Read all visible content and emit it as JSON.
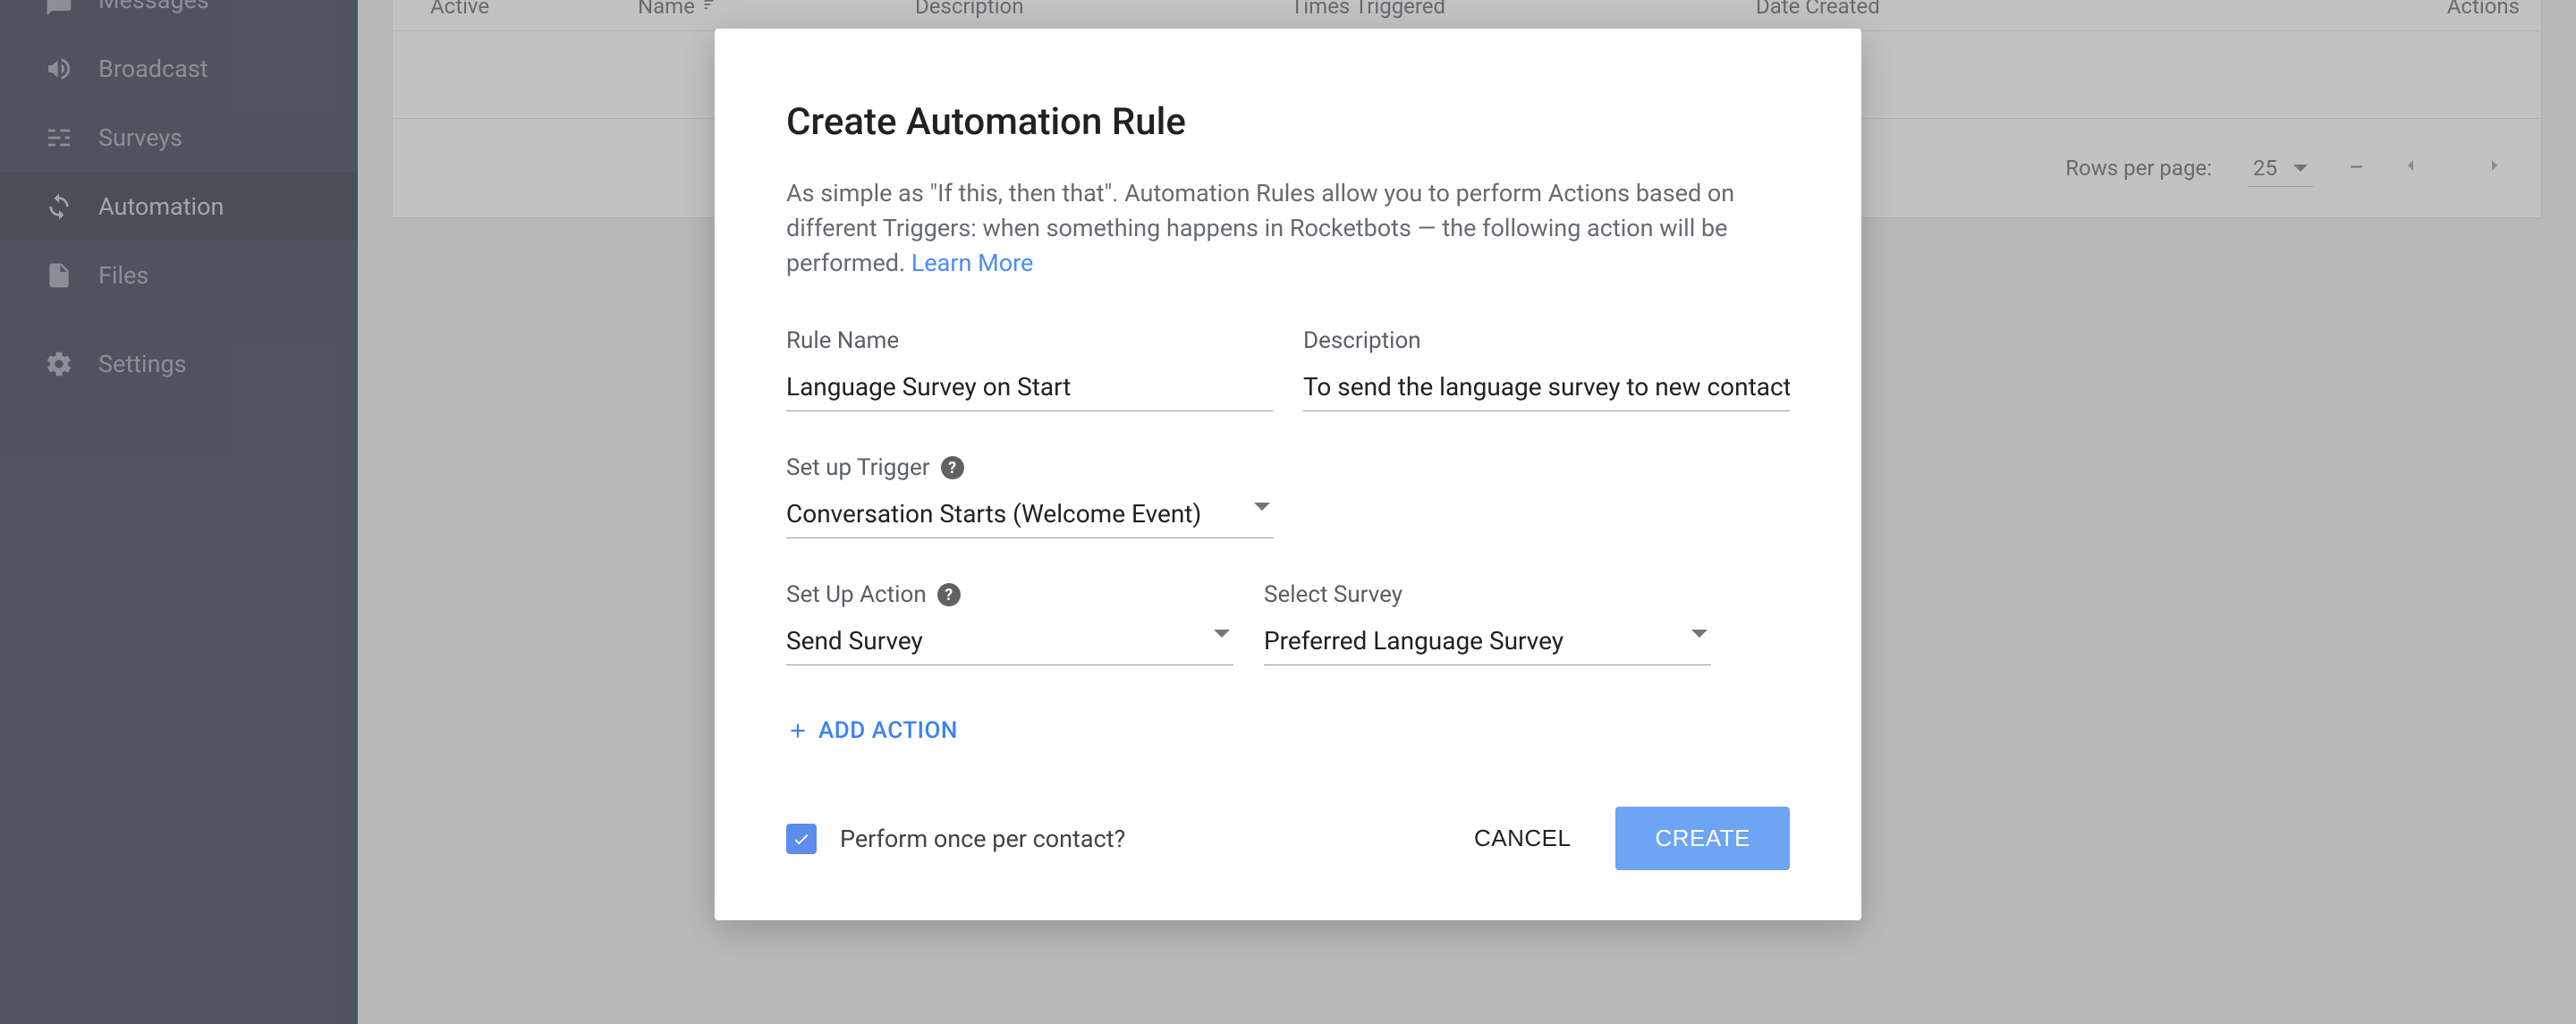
{
  "sidebar": {
    "items": [
      {
        "label": "Messages",
        "icon": "chat"
      },
      {
        "label": "Broadcast",
        "icon": "megaphone"
      },
      {
        "label": "Surveys",
        "icon": "sliders"
      },
      {
        "label": "Automation",
        "icon": "sync",
        "active": true
      },
      {
        "label": "Files",
        "icon": "file"
      },
      {
        "label": "Settings",
        "icon": "gear"
      }
    ]
  },
  "table": {
    "columns": {
      "active": "Active",
      "name": "Name",
      "description": "Description",
      "times_triggered": "Times Triggered",
      "date_created": "Date Created",
      "actions": "Actions"
    },
    "pager": {
      "rows_per_page_label": "Rows per page:",
      "rows_value": "25",
      "range": "–"
    }
  },
  "modal": {
    "title": "Create Automation Rule",
    "description_pre": "As simple as \"If this, then that\". Automation Rules allow you to perform Actions based on different Triggers: when something happens in Rocketbots — the following action will be performed. ",
    "learn_more": "Learn More",
    "fields": {
      "rule_name_label": "Rule Name",
      "rule_name_value": "Language Survey on Start",
      "description_label": "Description",
      "description_value": "To send the language survey to new contacts",
      "trigger_label": "Set up Trigger",
      "trigger_value": "Conversation Starts (Welcome Event)",
      "action_label": "Set Up Action",
      "action_value": "Send Survey",
      "select_survey_label": "Select Survey",
      "select_survey_value": "Preferred Language Survey"
    },
    "add_action": "ADD ACTION",
    "perform_once": "Perform once per contact?",
    "cancel": "CANCEL",
    "create": "CREATE"
  }
}
